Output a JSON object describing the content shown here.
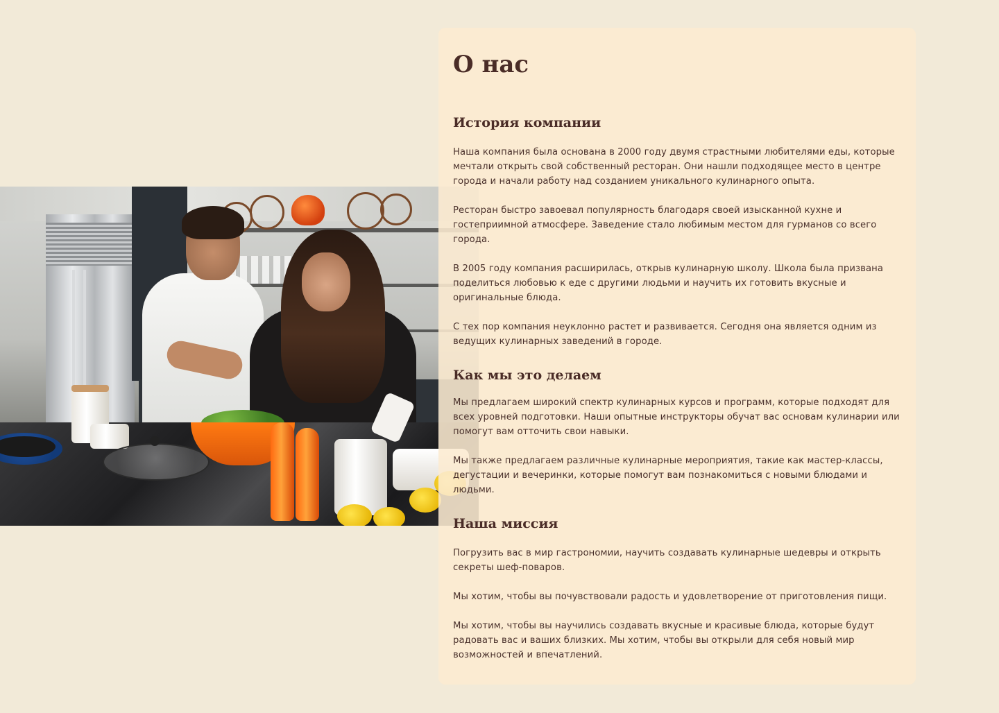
{
  "about": {
    "title": "О нас",
    "sections": [
      {
        "heading": "История компании",
        "paragraphs": [
          "Наша компания была основана в 2000 году двумя страстными любителями еды, которые мечтали открыть свой собственный ресторан. Они нашли подходящее место в центре города и начали работу над созданием уникального кулинарного опыта.",
          "Ресторан быстро завоевал популярность благодаря своей изысканной кухне и гостеприимной атмосфере. Заведение стало любимым местом для гурманов со всего города.",
          "В 2005 году компания расширилась, открыв кулинарную школу. Школа была призвана поделиться любовью к еде с другими людьми и научить их готовить вкусные и оригинальные блюда.",
          "С тех пор компания неуклонно растет и развивается. Сегодня она является одним из ведущих кулинарных заведений в городе."
        ]
      },
      {
        "heading": "Как мы это делаем",
        "paragraphs": [
          "Мы предлагаем широкий спектр кулинарных курсов и программ, которые подходят для всех уровней подготовки. Наши опытные инструкторы обучат вас основам кулинарии или помогут вам отточить свои навыки.",
          "Мы также предлагаем различные кулинарные мероприятия, такие как мастер-классы, дегустации и вечеринки, которые помогут вам познакомиться с новыми блюдами и людьми."
        ]
      },
      {
        "heading": "Наша миссия",
        "paragraphs": [
          "Погрузить вас в мир гастрономии, научить создавать кулинарные шедевры и открыть секреты шеф-поваров.",
          "Мы хотим, чтобы вы почувствовали радость и удовлетворение от приготовления пищи.",
          "Мы хотим, чтобы вы научились создавать вкусные и красивые блюда, которые будут радовать вас и ваших близких. Мы хотим, чтобы вы открыли для себя новый мир возможностей и впечатлений."
        ]
      }
    ]
  },
  "colors": {
    "page_background": "#f2ead8",
    "card_background": "#fcebd0",
    "heading_text": "#4a2c27",
    "body_text": "#4a312c"
  },
  "image": {
    "subject": "photo-couple-cooking-in-kitchen"
  }
}
